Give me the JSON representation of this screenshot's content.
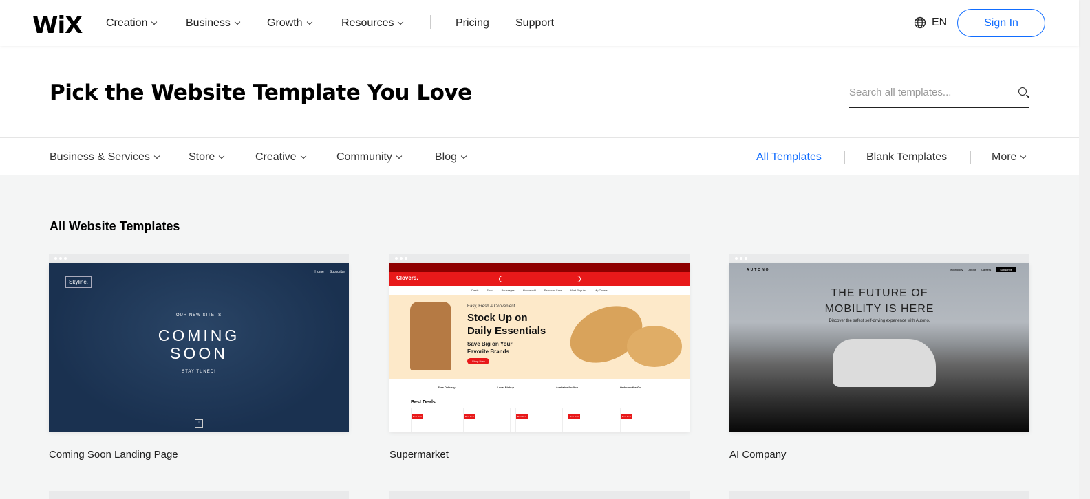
{
  "nav": {
    "logo": "WiX",
    "items": [
      "Creation",
      "Business",
      "Growth",
      "Resources"
    ],
    "links": [
      "Pricing",
      "Support"
    ],
    "language": "EN",
    "sign_in": "Sign In"
  },
  "hero": {
    "title": "Pick the Website Template You Love",
    "search_placeholder": "Search all templates..."
  },
  "filter": {
    "categories": [
      "Business & Services",
      "Store",
      "Creative",
      "Community",
      "Blog"
    ],
    "right": [
      "All Templates",
      "Blank Templates",
      "More"
    ],
    "active": "All Templates"
  },
  "accent": "#116dff",
  "section_title": "All Website Templates",
  "templates": [
    {
      "name": "Coming Soon Landing Page",
      "brand": "Skyline.",
      "nav": [
        "Home",
        "Subscribe"
      ],
      "kicker": "OUR NEW SITE IS",
      "headline1": "COMING",
      "headline2": "SOON",
      "sub": "STAY TUNED!"
    },
    {
      "name": "Supermarket",
      "brand": "Clovers.",
      "menu": [
        "Deals",
        "Food",
        "Beverages",
        "Household",
        "Personal Care",
        "Most Popular",
        "My Orders"
      ],
      "kicker": "Easy, Fresh & Convenient",
      "headline1": "Stock Up on",
      "headline2": "Daily Essentials",
      "sub": "Save Big on Your Favorite Brands",
      "cta": "Shop Now",
      "features": [
        "Free Delivery",
        "Local Pickup",
        "Available for You",
        "Order on the Go"
      ],
      "deals": "Best Deals",
      "badge": "Best Deal"
    },
    {
      "name": "AI Company",
      "brand": "AUTONO",
      "nav": [
        "Technology",
        "About",
        "Careers",
        "Subscribe"
      ],
      "headline1": "THE FUTURE OF",
      "headline2": "MOBILITY IS HERE",
      "sub": "Discover the safest self-driving experience with Autono."
    }
  ]
}
